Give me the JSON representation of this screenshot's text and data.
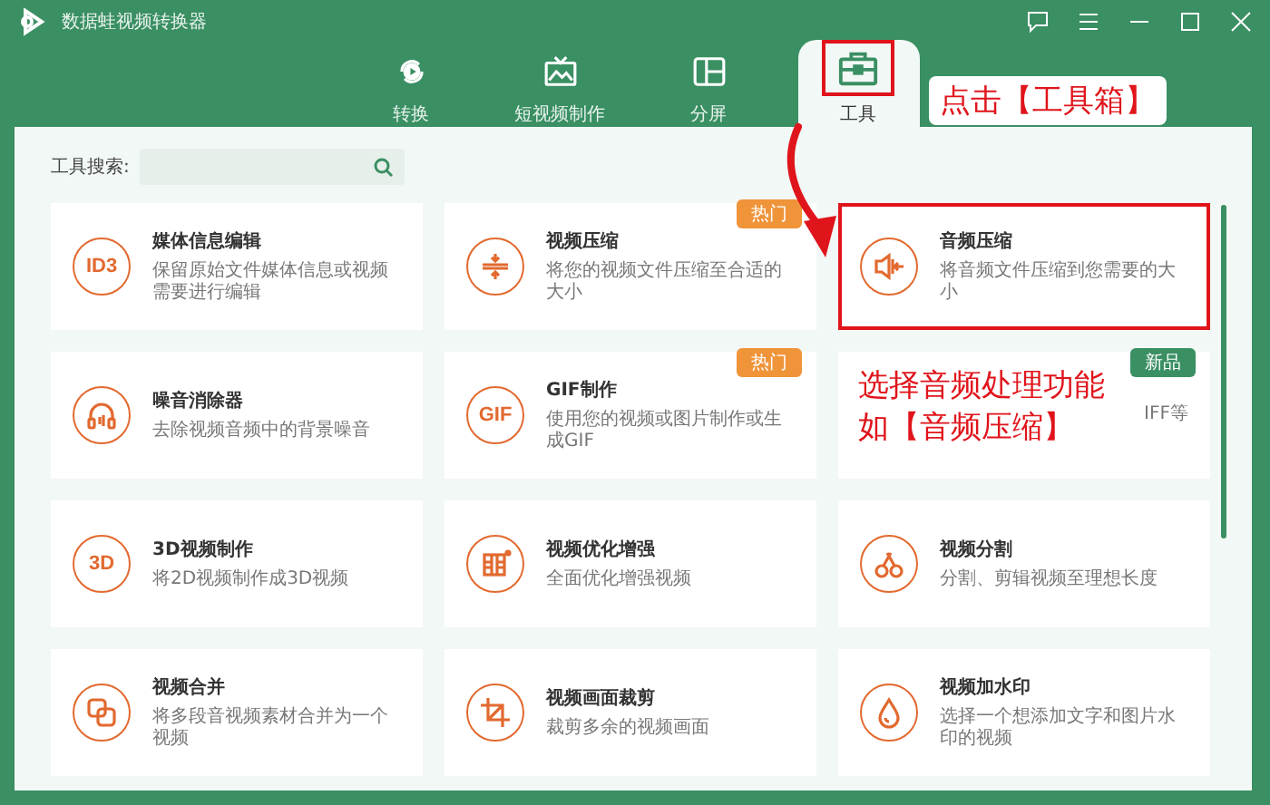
{
  "window": {
    "title": "数据蛙视频转换器"
  },
  "tabs": [
    {
      "label": "转换",
      "kind": "convert",
      "selected": false,
      "highlighted": false
    },
    {
      "label": "短视频制作",
      "kind": "tv",
      "selected": false,
      "highlighted": false
    },
    {
      "label": "分屏",
      "kind": "split",
      "selected": false,
      "highlighted": false
    },
    {
      "label": "工具",
      "kind": "toolbox",
      "selected": true,
      "highlighted": true
    }
  ],
  "search": {
    "label": "工具搜索:"
  },
  "tools": [
    {
      "title": "媒体信息编辑",
      "description": "保留原始文件媒体信息或视频需要进行编辑",
      "kind": "lettered",
      "icon_text": "ID3",
      "highlighted": false
    },
    {
      "title": "视频压缩",
      "description": "将您的视频文件压缩至合适的大小",
      "kind": "compress",
      "highlighted": false,
      "badge": {
        "text": "热门",
        "color": "#f0943a"
      }
    },
    {
      "title": "音频压缩",
      "description": "将音频文件压缩到您需要的大小",
      "kind": "speaker",
      "highlighted": true
    },
    {
      "title": "噪音消除器",
      "description": "去除视频音频中的背景噪音",
      "kind": "headphones",
      "highlighted": false
    },
    {
      "title": "GIF制作",
      "description": "使用您的视频或图片制作或生成GIF",
      "kind": "lettered",
      "icon_text": "GIF",
      "highlighted": false,
      "badge": {
        "text": "热门",
        "color": "#f0943a"
      }
    },
    {
      "description": "IFF等",
      "kind": "covered",
      "highlighted": false,
      "badge": {
        "text": "新品",
        "color": "#3a8f63"
      }
    },
    {
      "title": "3D视频制作",
      "description": "将2D视频制作成3D视频",
      "kind": "lettered",
      "icon_text": "3D",
      "highlighted": false
    },
    {
      "title": "视频优化增强",
      "description": "全面优化增强视频",
      "kind": "film",
      "highlighted": false
    },
    {
      "title": "视频分割",
      "description": "分割、剪辑视频至理想长度",
      "kind": "scissors",
      "highlighted": false
    },
    {
      "title": "视频合并",
      "description": "将多段音视频素材合并为一个视频",
      "kind": "squares",
      "highlighted": false
    },
    {
      "title": "视频画面裁剪",
      "description": "裁剪多余的视频画面",
      "kind": "crop",
      "highlighted": false
    },
    {
      "title": "视频加水印",
      "description": "选择一个想添加文字和图片水印的视频",
      "kind": "drop",
      "highlighted": false
    }
  ],
  "annotations": [
    {
      "kind": "callout",
      "lines": [
        "点击【工具箱】"
      ]
    },
    {
      "kind": "arrow"
    },
    {
      "kind": "note",
      "lines": [
        "选择音频处理功能",
        "如【音频压缩】"
      ]
    }
  ]
}
